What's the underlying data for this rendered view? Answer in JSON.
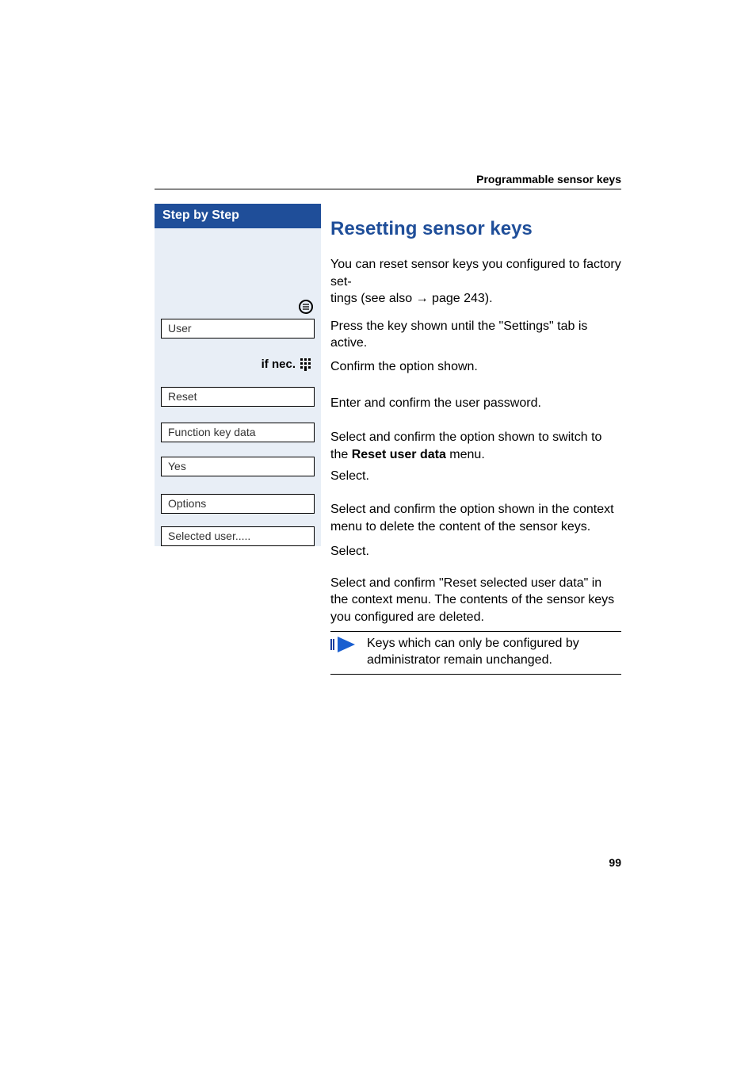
{
  "running_head": "Programmable sensor keys",
  "page_number": "99",
  "left": {
    "step_header": "Step by Step",
    "if_nec_label": "if nec.",
    "menu": {
      "user": "User",
      "reset": "Reset",
      "function_key_data": "Function key data",
      "yes": "Yes",
      "options": "Options",
      "selected_user": "Selected user....."
    }
  },
  "right": {
    "heading": "Resetting sensor keys",
    "intro_a": "You can reset sensor keys you configured to factory set-",
    "intro_b": "tings (see also ",
    "intro_arrow": "→",
    "intro_c": " page 243).",
    "press_key": "Press the key shown until the \"Settings\" tab is active.",
    "confirm_option": "Confirm the option shown.",
    "enter_password": "Enter and confirm the user password.",
    "reset_select_a": "Select and confirm the option shown to switch to the ",
    "reset_select_bold": "Reset user data",
    "reset_select_b": " menu.",
    "select_1": "Select.",
    "yes_text": "Select and confirm the option shown in the context menu to delete the content of the sensor keys.",
    "select_2": "Select.",
    "selected_user_text": "Select and confirm \"Reset selected user data\" in the context menu. The contents of the sensor keys you configured are deleted.",
    "note": "Keys which can only be configured by administra­tor remain unchanged."
  }
}
